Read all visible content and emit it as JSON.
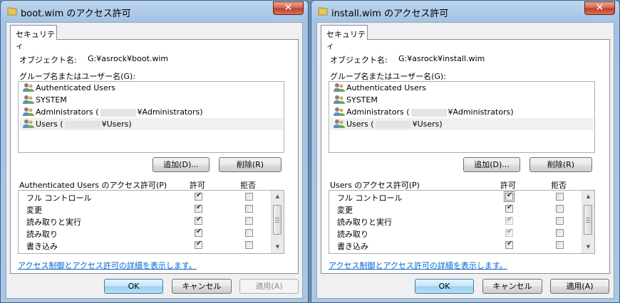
{
  "colors": {
    "link": "#0066cc",
    "close": "#c23e24"
  },
  "left": {
    "title": "boot.wim のアクセス許可",
    "tab": "セキュリティ",
    "object_label": "オブジェクト名:",
    "object_value": "G:¥asrock¥boot.wim",
    "group_label": "グループ名またはユーザー名(G):",
    "users": [
      {
        "pre": "Authenticated Users",
        "post": ""
      },
      {
        "pre": "SYSTEM",
        "post": ""
      },
      {
        "pre": "Administrators (",
        "post": "¥Administrators)"
      },
      {
        "pre": "Users (",
        "post": "¥Users)"
      }
    ],
    "add_button": "追加(D)...",
    "remove_button": "削除(R)",
    "perm_header": "Authenticated Users のアクセス許可(P)",
    "allow_header": "許可",
    "deny_header": "拒否",
    "permissions": [
      {
        "name": "フル コントロール",
        "allow": "checked",
        "deny": "unchecked"
      },
      {
        "name": "変更",
        "allow": "checked",
        "deny": "unchecked"
      },
      {
        "name": "読み取りと実行",
        "allow": "checked",
        "deny": "unchecked"
      },
      {
        "name": "読み取り",
        "allow": "checked",
        "deny": "unchecked"
      },
      {
        "name": "書き込み",
        "allow": "checked",
        "deny": "unchecked"
      }
    ],
    "link": "アクセス制御とアクセス許可の詳細を表示します。",
    "ok": "OK",
    "cancel": "キャンセル",
    "apply": "適用(A)"
  },
  "right": {
    "title": "install.wim のアクセス許可",
    "tab": "セキュリティ",
    "object_label": "オブジェクト名:",
    "object_value": "G:¥asrock¥install.wim",
    "group_label": "グループ名またはユーザー名(G):",
    "users": [
      {
        "pre": "Authenticated Users",
        "post": ""
      },
      {
        "pre": "SYSTEM",
        "post": ""
      },
      {
        "pre": "Administrators (",
        "post": "¥Administrators)"
      },
      {
        "pre": "Users (",
        "post": "¥Users)"
      }
    ],
    "add_button": "追加(D)...",
    "remove_button": "削除(R)",
    "perm_header": "Users のアクセス許可(P)",
    "allow_header": "許可",
    "deny_header": "拒否",
    "permissions": [
      {
        "name": "フル コントロール",
        "allow": "checked-focus",
        "deny": "unchecked"
      },
      {
        "name": "変更",
        "allow": "checked",
        "deny": "unchecked"
      },
      {
        "name": "読み取りと実行",
        "allow": "checked-dim",
        "deny": "unchecked"
      },
      {
        "name": "読み取り",
        "allow": "checked-dim",
        "deny": "unchecked"
      },
      {
        "name": "書き込み",
        "allow": "checked",
        "deny": "unchecked"
      }
    ],
    "link": "アクセス制御とアクセス許可の詳細を表示します。",
    "ok": "OK",
    "cancel": "キャンセル",
    "apply": "適用(A)"
  }
}
